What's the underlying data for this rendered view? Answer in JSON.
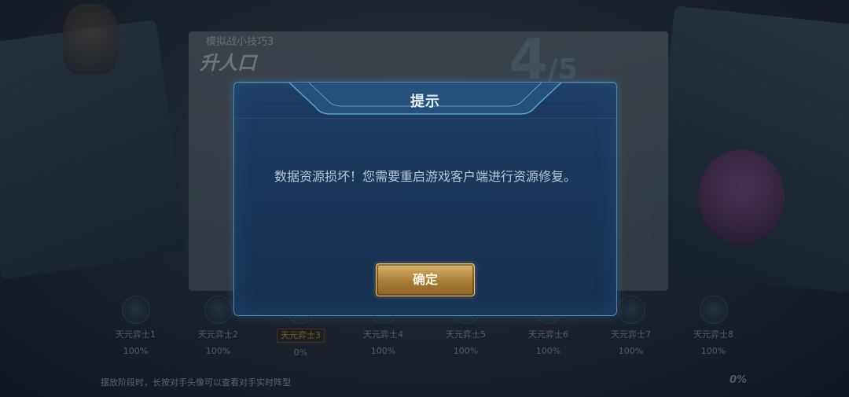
{
  "background": {
    "tip_label": "模拟战小技巧3",
    "tip_title": "升人口",
    "tip_counter": "4",
    "tip_counter_total": "/5",
    "players": [
      {
        "name": "天元弈士1",
        "pct": "100%",
        "active": false
      },
      {
        "name": "天元弈士2",
        "pct": "100%",
        "active": false
      },
      {
        "name": "天元弈士3",
        "pct": "0%",
        "active": true
      },
      {
        "name": "天元弈士4",
        "pct": "100%",
        "active": false
      },
      {
        "name": "天元弈士5",
        "pct": "100%",
        "active": false
      },
      {
        "name": "天元弈士6",
        "pct": "100%",
        "active": false
      },
      {
        "name": "天元弈士7",
        "pct": "100%",
        "active": false
      },
      {
        "name": "天元弈士8",
        "pct": "100%",
        "active": false
      }
    ],
    "footer_hint": "摆放阶段时，长按对手头像可以查看对手实时阵型",
    "loading_pct": "0%"
  },
  "dialog": {
    "title": "提示",
    "message": "数据资源损坏！您需要重启游戏客户端进行资源修复。",
    "confirm_label": "确定"
  },
  "colors": {
    "dialog_border": "#4d88b8",
    "dialog_bg": "#1a3658",
    "button_gold": "#c49a4e",
    "active_player": "#d9a93a"
  }
}
